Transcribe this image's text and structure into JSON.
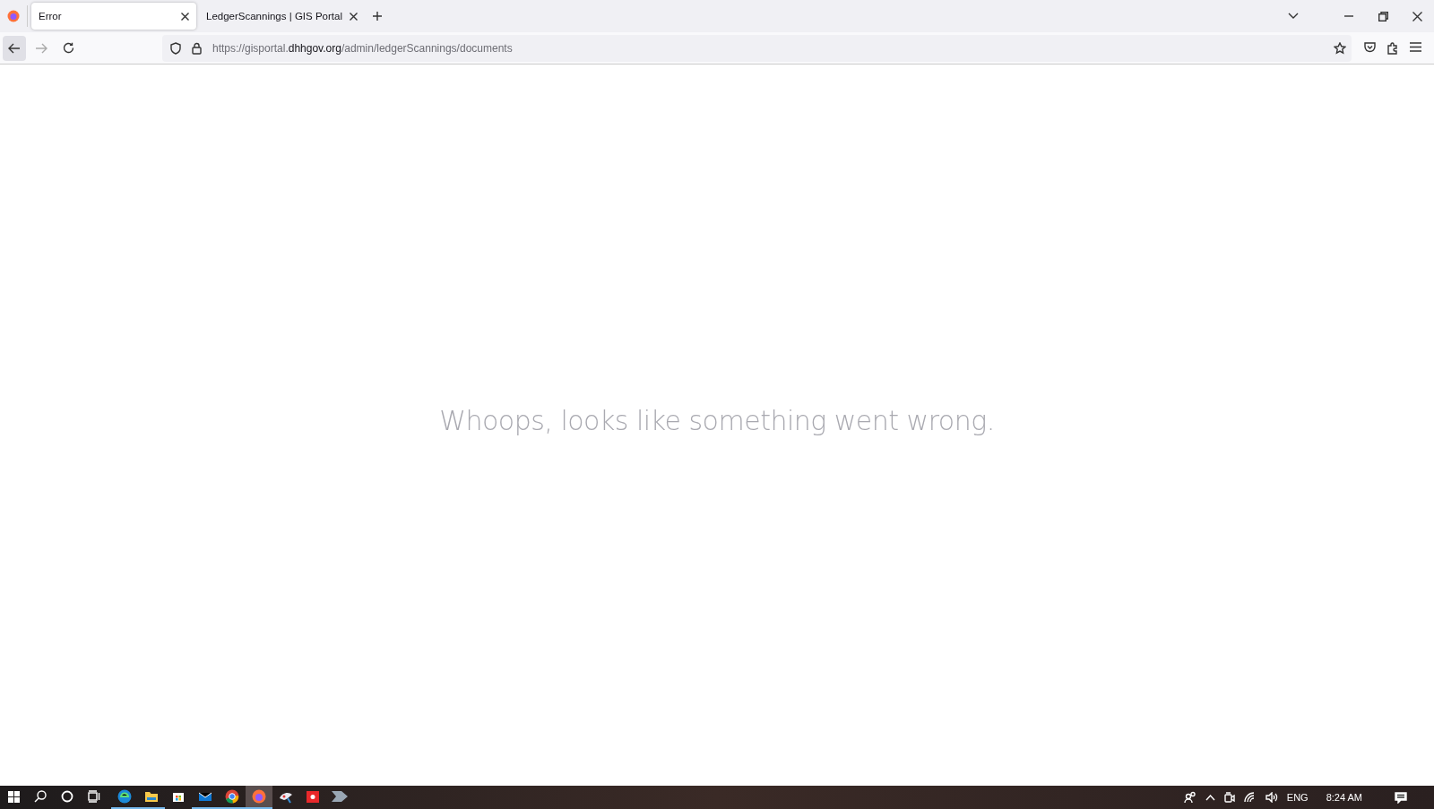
{
  "tabs": [
    {
      "label": "Error",
      "selected": true
    },
    {
      "label": "LedgerScannings | GIS Portal",
      "selected": false
    }
  ],
  "address_bar": {
    "url_prefix": "https://gisportal.",
    "url_domain": "dhhgov.org",
    "url_path": "/admin/ledgerScannings/documents"
  },
  "page": {
    "message": "Whoops, looks like something went wrong."
  },
  "taskbar": {
    "apps": [
      {
        "kind": "edge",
        "running": true,
        "selected": false
      },
      {
        "kind": "files",
        "running": true,
        "selected": false
      },
      {
        "kind": "store",
        "running": false,
        "selected": false
      },
      {
        "kind": "mail",
        "running": true,
        "selected": false
      },
      {
        "kind": "chrome",
        "running": true,
        "selected": false
      },
      {
        "kind": "firefox",
        "running": true,
        "selected": true
      },
      {
        "kind": "paint",
        "running": false,
        "selected": false
      },
      {
        "kind": "recorder",
        "running": false,
        "selected": false
      },
      {
        "kind": "arrow",
        "running": false,
        "selected": false
      }
    ],
    "language": "ENG",
    "time": "8:24 AM"
  }
}
